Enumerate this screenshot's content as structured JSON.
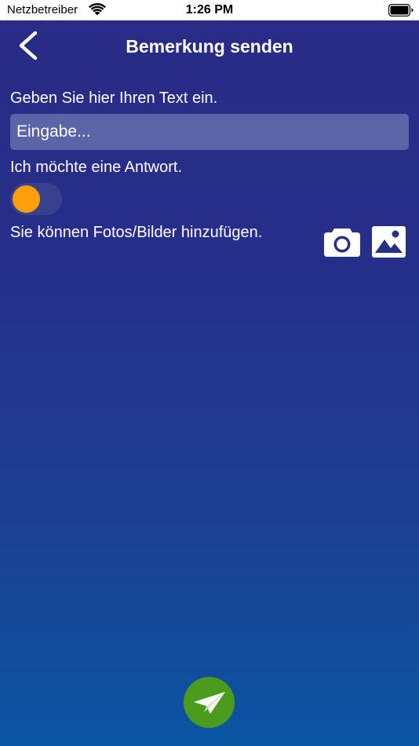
{
  "status_bar": {
    "carrier": "Netzbetreiber",
    "time": "1:26 PM",
    "icons": [
      "wifi-icon",
      "battery-icon"
    ]
  },
  "header": {
    "title": "Bemerkung senden",
    "back_icon": "chevron-left-icon"
  },
  "form": {
    "text_label": "Geben Sie hier Ihren Text ein.",
    "text_input": {
      "value": "",
      "placeholder": "Eingabe..."
    },
    "reply_label": "Ich möchte eine Antwort.",
    "reply_toggle": {
      "on": false,
      "knob_color": "#ff9f0a"
    },
    "photos_label": "Sie können Fotos/Bilder hinzufügen.",
    "photo_icons": [
      "camera-icon",
      "image-icon"
    ]
  },
  "actions": {
    "send_icon": "paper-plane-icon",
    "send_color": "#4a9b1e"
  },
  "colors": {
    "background_top": "#2a2b85",
    "background_bottom": "#0a55a2",
    "input_bg": "#5a64a6",
    "accent": "#ff9f0a"
  }
}
